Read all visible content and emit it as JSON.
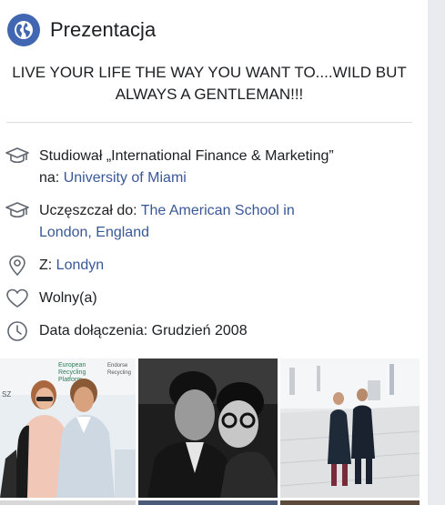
{
  "section": {
    "title": "Prezentacja",
    "icon": "globe-icon"
  },
  "bio": "LIVE YOUR LIFE THE WAY YOU WANT TO....WILD BUT ALWAYS A GENTLEMAN!!!",
  "info": {
    "education": {
      "icon": "graduation-cap-icon",
      "prefix": "Studiował „International Finance & Marketing”",
      "prefix2": "na:",
      "link": "University of Miami"
    },
    "school": {
      "icon": "graduation-cap-icon",
      "prefix": "Uczęszczał do:",
      "link_line1": "The American School in",
      "link_line2": "London, England"
    },
    "location": {
      "icon": "location-pin-icon",
      "prefix": "Z:",
      "link": "Londyn"
    },
    "relationship": {
      "icon": "heart-icon",
      "text": "Wolny(a)"
    },
    "joined": {
      "icon": "clock-icon",
      "text": "Data dołączenia: Grudzień 2008"
    }
  },
  "photos": {
    "photo1": {
      "sign_line1": "European",
      "sign_line2": "Recycling",
      "sign_line3": "Platform",
      "sign_right1": "Endorse",
      "sign_right2": "Recycling",
      "sign_left": "SZ"
    }
  },
  "colors": {
    "link": "#385898",
    "accent": "#4267b2",
    "divider": "#dadde1",
    "background": "#e9ebee"
  }
}
